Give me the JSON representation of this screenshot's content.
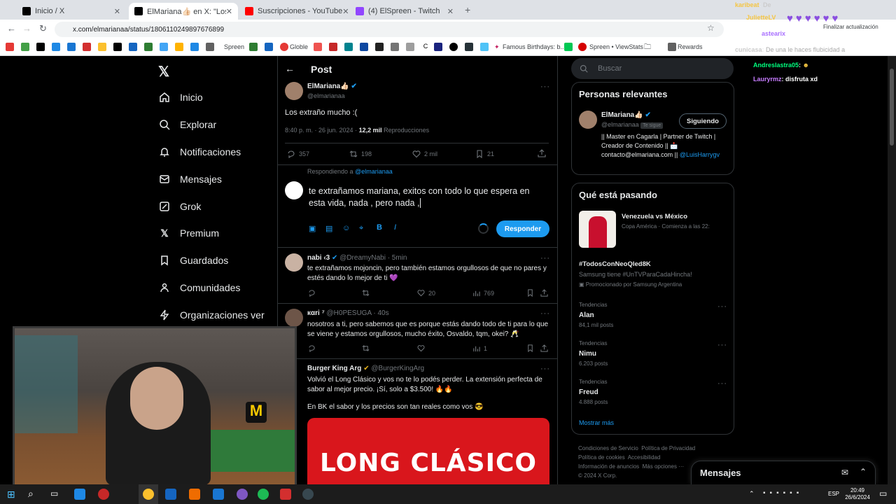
{
  "browser": {
    "tabs": [
      {
        "title": "Inicio / X",
        "color": "#000000"
      },
      {
        "title": "ElMariana👍🏻 en X: \"Los extraño",
        "color": "#000000"
      },
      {
        "title": "Suscripciones - YouTube",
        "color": "#ff0000"
      },
      {
        "title": "(4) ElSpreen - Twitch",
        "color": "#9146ff"
      }
    ],
    "url": "x.com/elmarianaa/status/1806110249897676899",
    "update_button": "Finalizar actualización",
    "bookmarks": {
      "spreen": "Spreen",
      "globle": "Globle",
      "famous": "Famous Birthdays: b...",
      "viewstats": "Spreen • ViewStats",
      "rewards": "Rewards"
    }
  },
  "sidebar": {
    "items": [
      {
        "label": "Inicio",
        "icon": "home-icon"
      },
      {
        "label": "Explorar",
        "icon": "search-icon"
      },
      {
        "label": "Notificaciones",
        "icon": "bell-icon"
      },
      {
        "label": "Mensajes",
        "icon": "mail-icon"
      },
      {
        "label": "Grok",
        "icon": "grok-icon"
      },
      {
        "label": "Premium",
        "icon": "x-logo-icon"
      },
      {
        "label": "Guardados",
        "icon": "bookmark-icon"
      },
      {
        "label": "Comunidades",
        "icon": "people-icon"
      },
      {
        "label": "Organizaciones ver",
        "icon": "lightning-icon"
      }
    ]
  },
  "post": {
    "header": "Post",
    "author": "ElMariana👍🏻",
    "handle": "@elmarianaa",
    "text": "Los extraño mucho :(",
    "time": "8:40 p. m. · 26 jun. 2024 ·",
    "views": "12,2 mil",
    "views_label": "Reproducciones",
    "replies": "357",
    "reposts": "198",
    "likes": "2 mil",
    "bookmarks": "21"
  },
  "reply_box": {
    "replying_prefix": "Respondiendo a",
    "replying_to": "@elmarianaa",
    "draft": "te extrañamos mariana, exitos con todo lo que espera en esta vida, nada , pero nada ,",
    "button": "Responder"
  },
  "replies": [
    {
      "name": "nabi ‹3",
      "handle": "@DreamyNabi · 5min",
      "text": "te extrañamos mojoncin, pero también estamos orgullosos de que no pares y estés dando lo mejor de ti 💜",
      "likes": "20",
      "views": "769"
    },
    {
      "name": "кαri ⁷",
      "handle": "@H0PESUGA · 40s",
      "text": "nosotros a ti, pero sabemos que es porque estás dando todo de ti para lo que se viene y estamos orgullosos, mucho éxito, Osvaldo, tqm, okei? 🥂",
      "likes": "",
      "views": "1"
    },
    {
      "name": "Burger King Arg",
      "handle": "@BurgerKingArg",
      "text": "Volvió el Long Clásico y vos no te lo podés perder. La extensión perfecta de sabor al mejor precio. ¡Sí, solo a $3.500! 🔥🔥",
      "text2": "En BK el sabor y los precios son tan reales como vos 😎",
      "ad_title": "LONG CLÁSICO"
    }
  ],
  "right": {
    "search_placeholder": "Buscar",
    "relevant_title": "Personas relevantes",
    "relevant": {
      "name": "ElMariana👍🏻",
      "handle": "@elmarianaa",
      "follows_you": "Te sigue",
      "follow_btn": "Siguiendo",
      "bio": "|| Master en Cagarla | Partner de Twitch | Creador de Contenido || 📩 contacto@elmariana.com ||",
      "bio_link": "@LuisHarrygv"
    },
    "trends_title": "Qué está pasando",
    "event": {
      "title": "Venezuela vs México",
      "sub": "Copa América · Comienza a las 22:"
    },
    "promo": {
      "tag": "#TodosConNeoQled8K",
      "text": "Samsung tiene #UnTVParaCadaHincha!",
      "promoted": "Promocionado por Samsung Argentina"
    },
    "trends": [
      {
        "label": "Tendencias",
        "name": "Alan",
        "posts": "84,1 mil posts"
      },
      {
        "label": "Tendencias",
        "name": "Nimu",
        "posts": "6.203 posts"
      },
      {
        "label": "Tendencias",
        "name": "Freud",
        "posts": "4.888 posts"
      }
    ],
    "show_more": "Mostrar más",
    "footer": [
      "Condiciones de Servicio",
      "Política de Privacidad",
      "Política de cookies",
      "Accesibilidad",
      "Información de anuncios",
      "Más opciones ···",
      "© 2024 X Corp."
    ],
    "messages": "Mensajes"
  },
  "chat": [
    {
      "user": "karibeat",
      "msg": "De",
      "color": "#f5c542"
    },
    {
      "user": "JulietteLV",
      "msg": "",
      "color": "#f5c542"
    },
    {
      "user": "astearix",
      "msg": "",
      "color": "#a970ff"
    },
    {
      "user": "cunicasa",
      "msg": "De una le haces flubicidad a",
      "color": "#cccccc"
    },
    {
      "user": "Andreslastra05",
      "msg": "",
      "color": "#00ff7f"
    },
    {
      "user": "Lauryrmz",
      "msg": "disfruta xd",
      "color": "#c77dff"
    }
  ],
  "taskbar": {
    "lang": "ESP",
    "time": "20:49",
    "date": "26/6/2024"
  }
}
